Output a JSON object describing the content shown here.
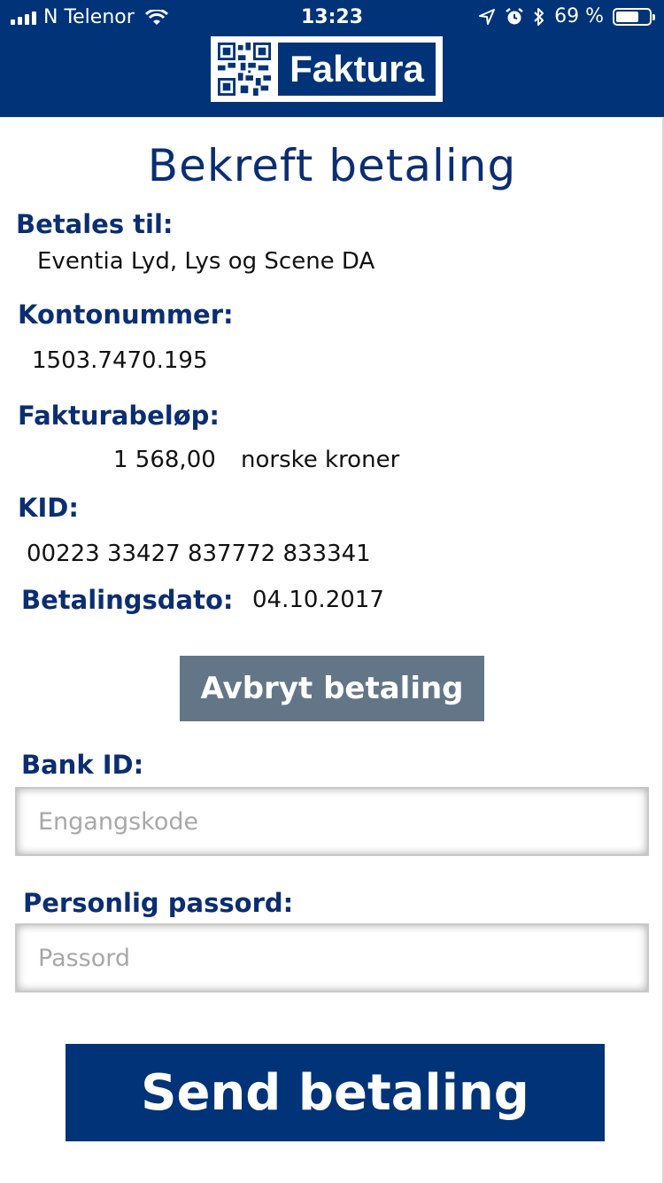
{
  "status_bar": {
    "carrier": "N Telenor",
    "time": "13:23",
    "battery": "69 %",
    "battery_level": 0.69
  },
  "brand": {
    "logo_text": "Faktura"
  },
  "page": {
    "title": "Bekreft betaling"
  },
  "invoice": {
    "payee_label": "Betales til:",
    "payee": "Eventia Lyd, Lys og Scene DA",
    "account_label": "Kontonummer:",
    "account": "1503.7470.195",
    "amount_label": "Fakturabeløp:",
    "amount": "1 568,00",
    "currency": "norske kroner",
    "kid_label": "KID:",
    "kid": "00223 33427 837772 833341",
    "date_label": "Betalingsdato:",
    "date": "04.10.2017"
  },
  "actions": {
    "cancel_label": "Avbryt betaling",
    "send_label": "Send betaling"
  },
  "auth": {
    "bankid_label": "Bank ID:",
    "otp_placeholder": "Engangskode",
    "otp_value": "",
    "password_label": "Personlig passord:",
    "password_placeholder": "Passord",
    "password_value": ""
  },
  "colors": {
    "brand_blue": "#003378",
    "label_blue": "#0b2e72",
    "cancel_gray": "#637687"
  }
}
